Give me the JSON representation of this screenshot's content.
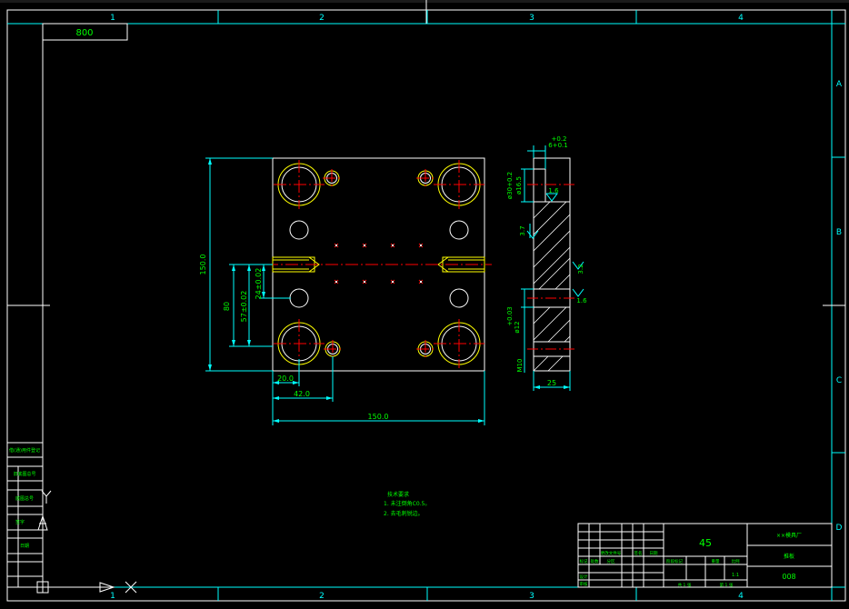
{
  "colors": {
    "background": "#000000",
    "frame_white": "#ffffff",
    "frame_green": "#00ff00",
    "centerline_red": "#ff0000",
    "cyan": "#00ffff",
    "yellow": "#ffff00"
  },
  "frame": {
    "zones_top": [
      "1",
      "2",
      "3",
      "4"
    ],
    "zones_bottom": [
      "1",
      "2",
      "3",
      "4"
    ],
    "zones_right": [
      "A",
      "B",
      "C",
      "D"
    ],
    "drawing_no_box": "800"
  },
  "dimensions": {
    "overall_height": "150.0",
    "height_80": "80",
    "height_57": "57±0.02",
    "height_24": "24±0.02",
    "width_20": "20.0",
    "width_42": "42.0",
    "overall_width": "150.0",
    "side_thickness": "25",
    "tol_top": "+0.2",
    "tol_top2": "6+0.1",
    "dia_upper_a": "ø30+0.2",
    "dia_upper_b": "ø16.5",
    "dia_lower": "ø12",
    "tol_lower": "+0.03",
    "thread": "M10",
    "depth_37": "3.7",
    "finish_16a": "1.6",
    "finish_16b": "1.6",
    "finish_32": "3.2"
  },
  "notes": {
    "title": "技术要求",
    "line1": "1. 未注倒角C0.5。",
    "line2": "2. 去毛刺锐边。"
  },
  "title_block": {
    "material": "45",
    "company": "××模具厂",
    "part_name": "推板",
    "drawing_no": "008",
    "scale": "1:1",
    "sheet_count": "1",
    "sheet": "1",
    "row_labels": [
      "标记",
      "设计",
      "审核",
      "工艺"
    ],
    "col_labels": [
      "处数",
      "分区",
      "更改文件号",
      "签名",
      "日期"
    ],
    "stage_label": "阶段标记",
    "weight_label": "重量",
    "scale_label": "比例",
    "page_a": "共 1 张",
    "page_b": "第 1 张"
  },
  "left_strip": {
    "items": [
      "借(通)用件登记",
      "旧底图总号",
      "底图总号",
      "签字",
      "日期"
    ]
  },
  "ucs": {
    "y_label": "Y",
    "x_label": "X"
  }
}
